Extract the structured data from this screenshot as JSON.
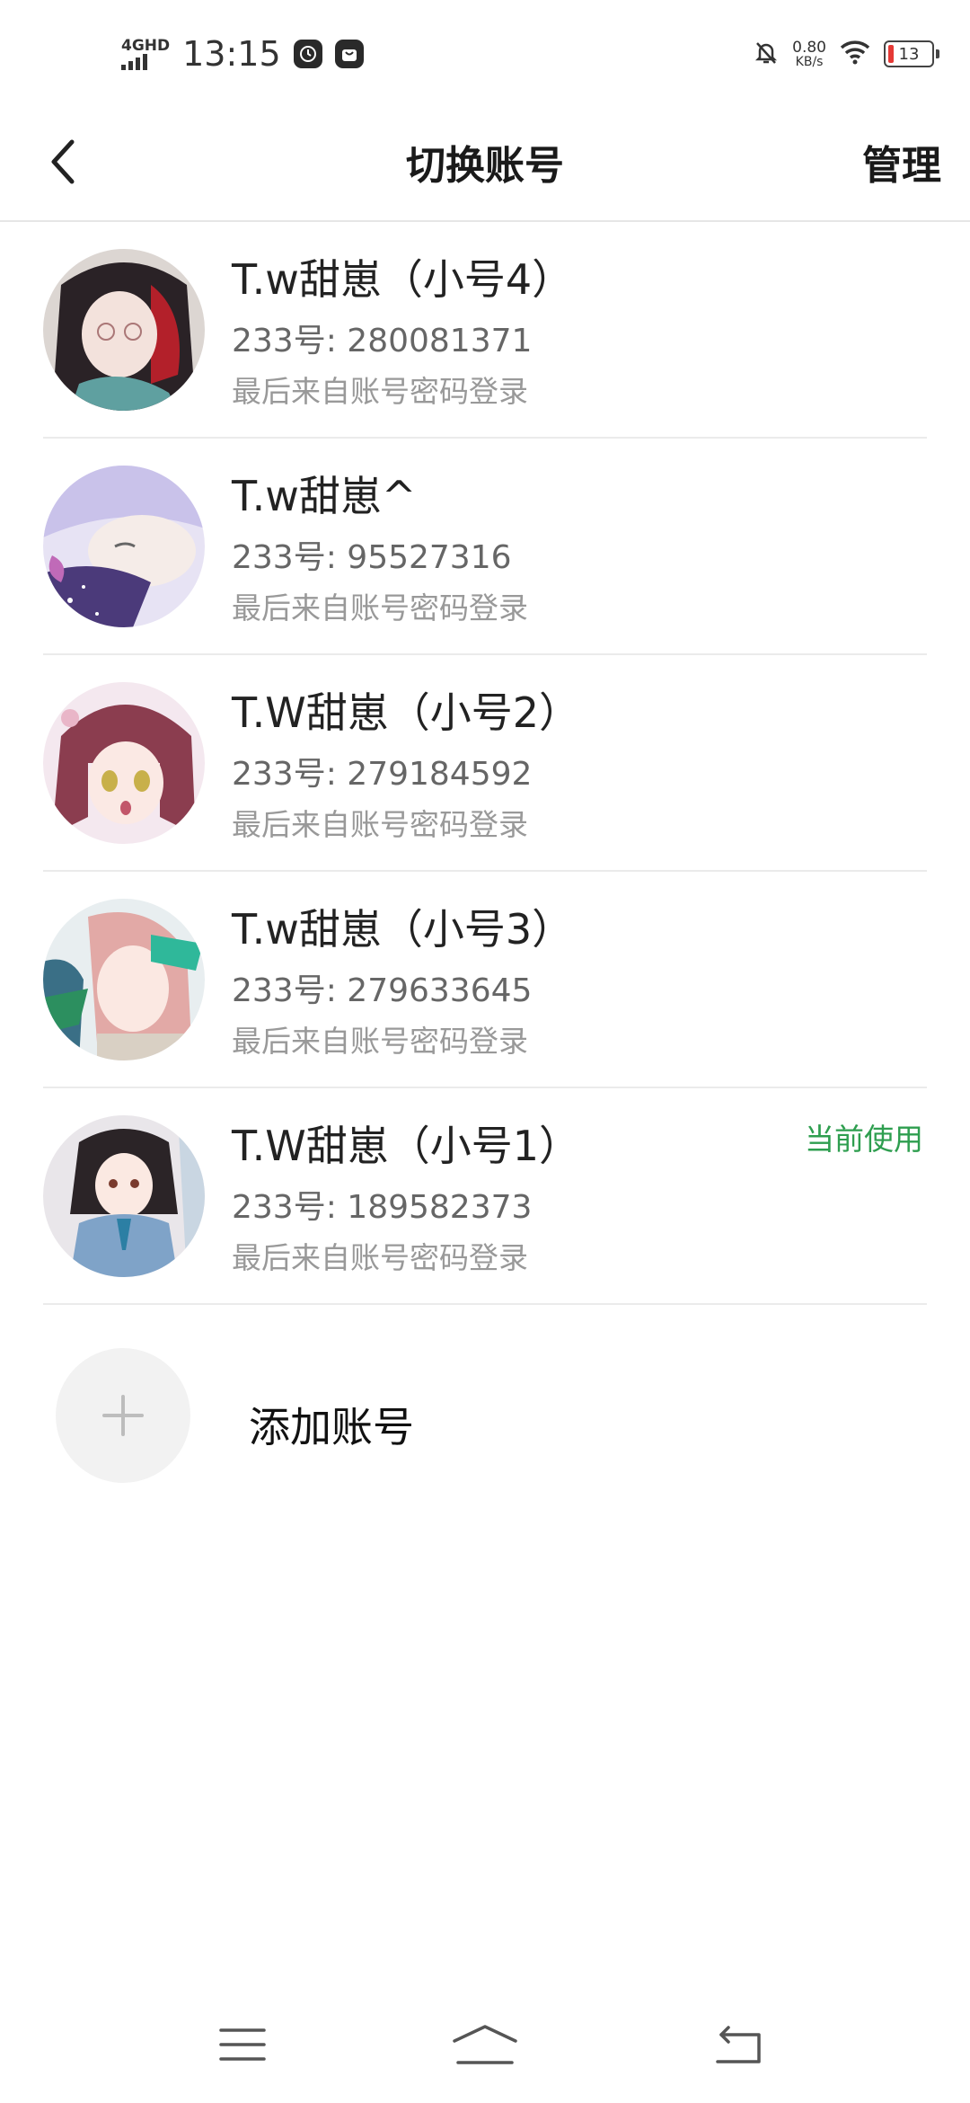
{
  "status_bar": {
    "network_type": "4GHD",
    "time": "13:15",
    "net_speed_value": "0.80",
    "net_speed_unit": "KB/s",
    "battery_level": "13",
    "icons": [
      "signal-icon",
      "clock-app-icon",
      "bag-app-icon",
      "mute-bell-icon",
      "wifi-icon",
      "battery-icon"
    ]
  },
  "header": {
    "title": "切换账号",
    "manage_label": "管理",
    "back_icon": "chevron-left-icon"
  },
  "accounts": [
    {
      "name": "T.w甜崽（小号4）",
      "id_text": "233号: 280081371",
      "login_text": "最后来自账号密码登录",
      "current": ""
    },
    {
      "name": "T.w甜崽^",
      "id_text": "233号: 95527316",
      "login_text": "最后来自账号密码登录",
      "current": ""
    },
    {
      "name": "T.W甜崽（小号2）",
      "id_text": "233号: 279184592",
      "login_text": "最后来自账号密码登录",
      "current": ""
    },
    {
      "name": "T.w甜崽（小号3）",
      "id_text": "233号: 279633645",
      "login_text": "最后来自账号密码登录",
      "current": ""
    },
    {
      "name": "T.W甜崽（小号1）",
      "id_text": "233号: 189582373",
      "login_text": "最后来自账号密码登录",
      "current": "当前使用"
    }
  ],
  "add_account": {
    "label": "添加账号",
    "icon": "plus-icon"
  },
  "colors": {
    "current_badge": "#2e9e4f",
    "divider": "#ebebeb",
    "add_circle": "#f2f2f2"
  },
  "nav_bar": {
    "icons": [
      "menu-icon",
      "home-icon",
      "back-icon"
    ]
  }
}
